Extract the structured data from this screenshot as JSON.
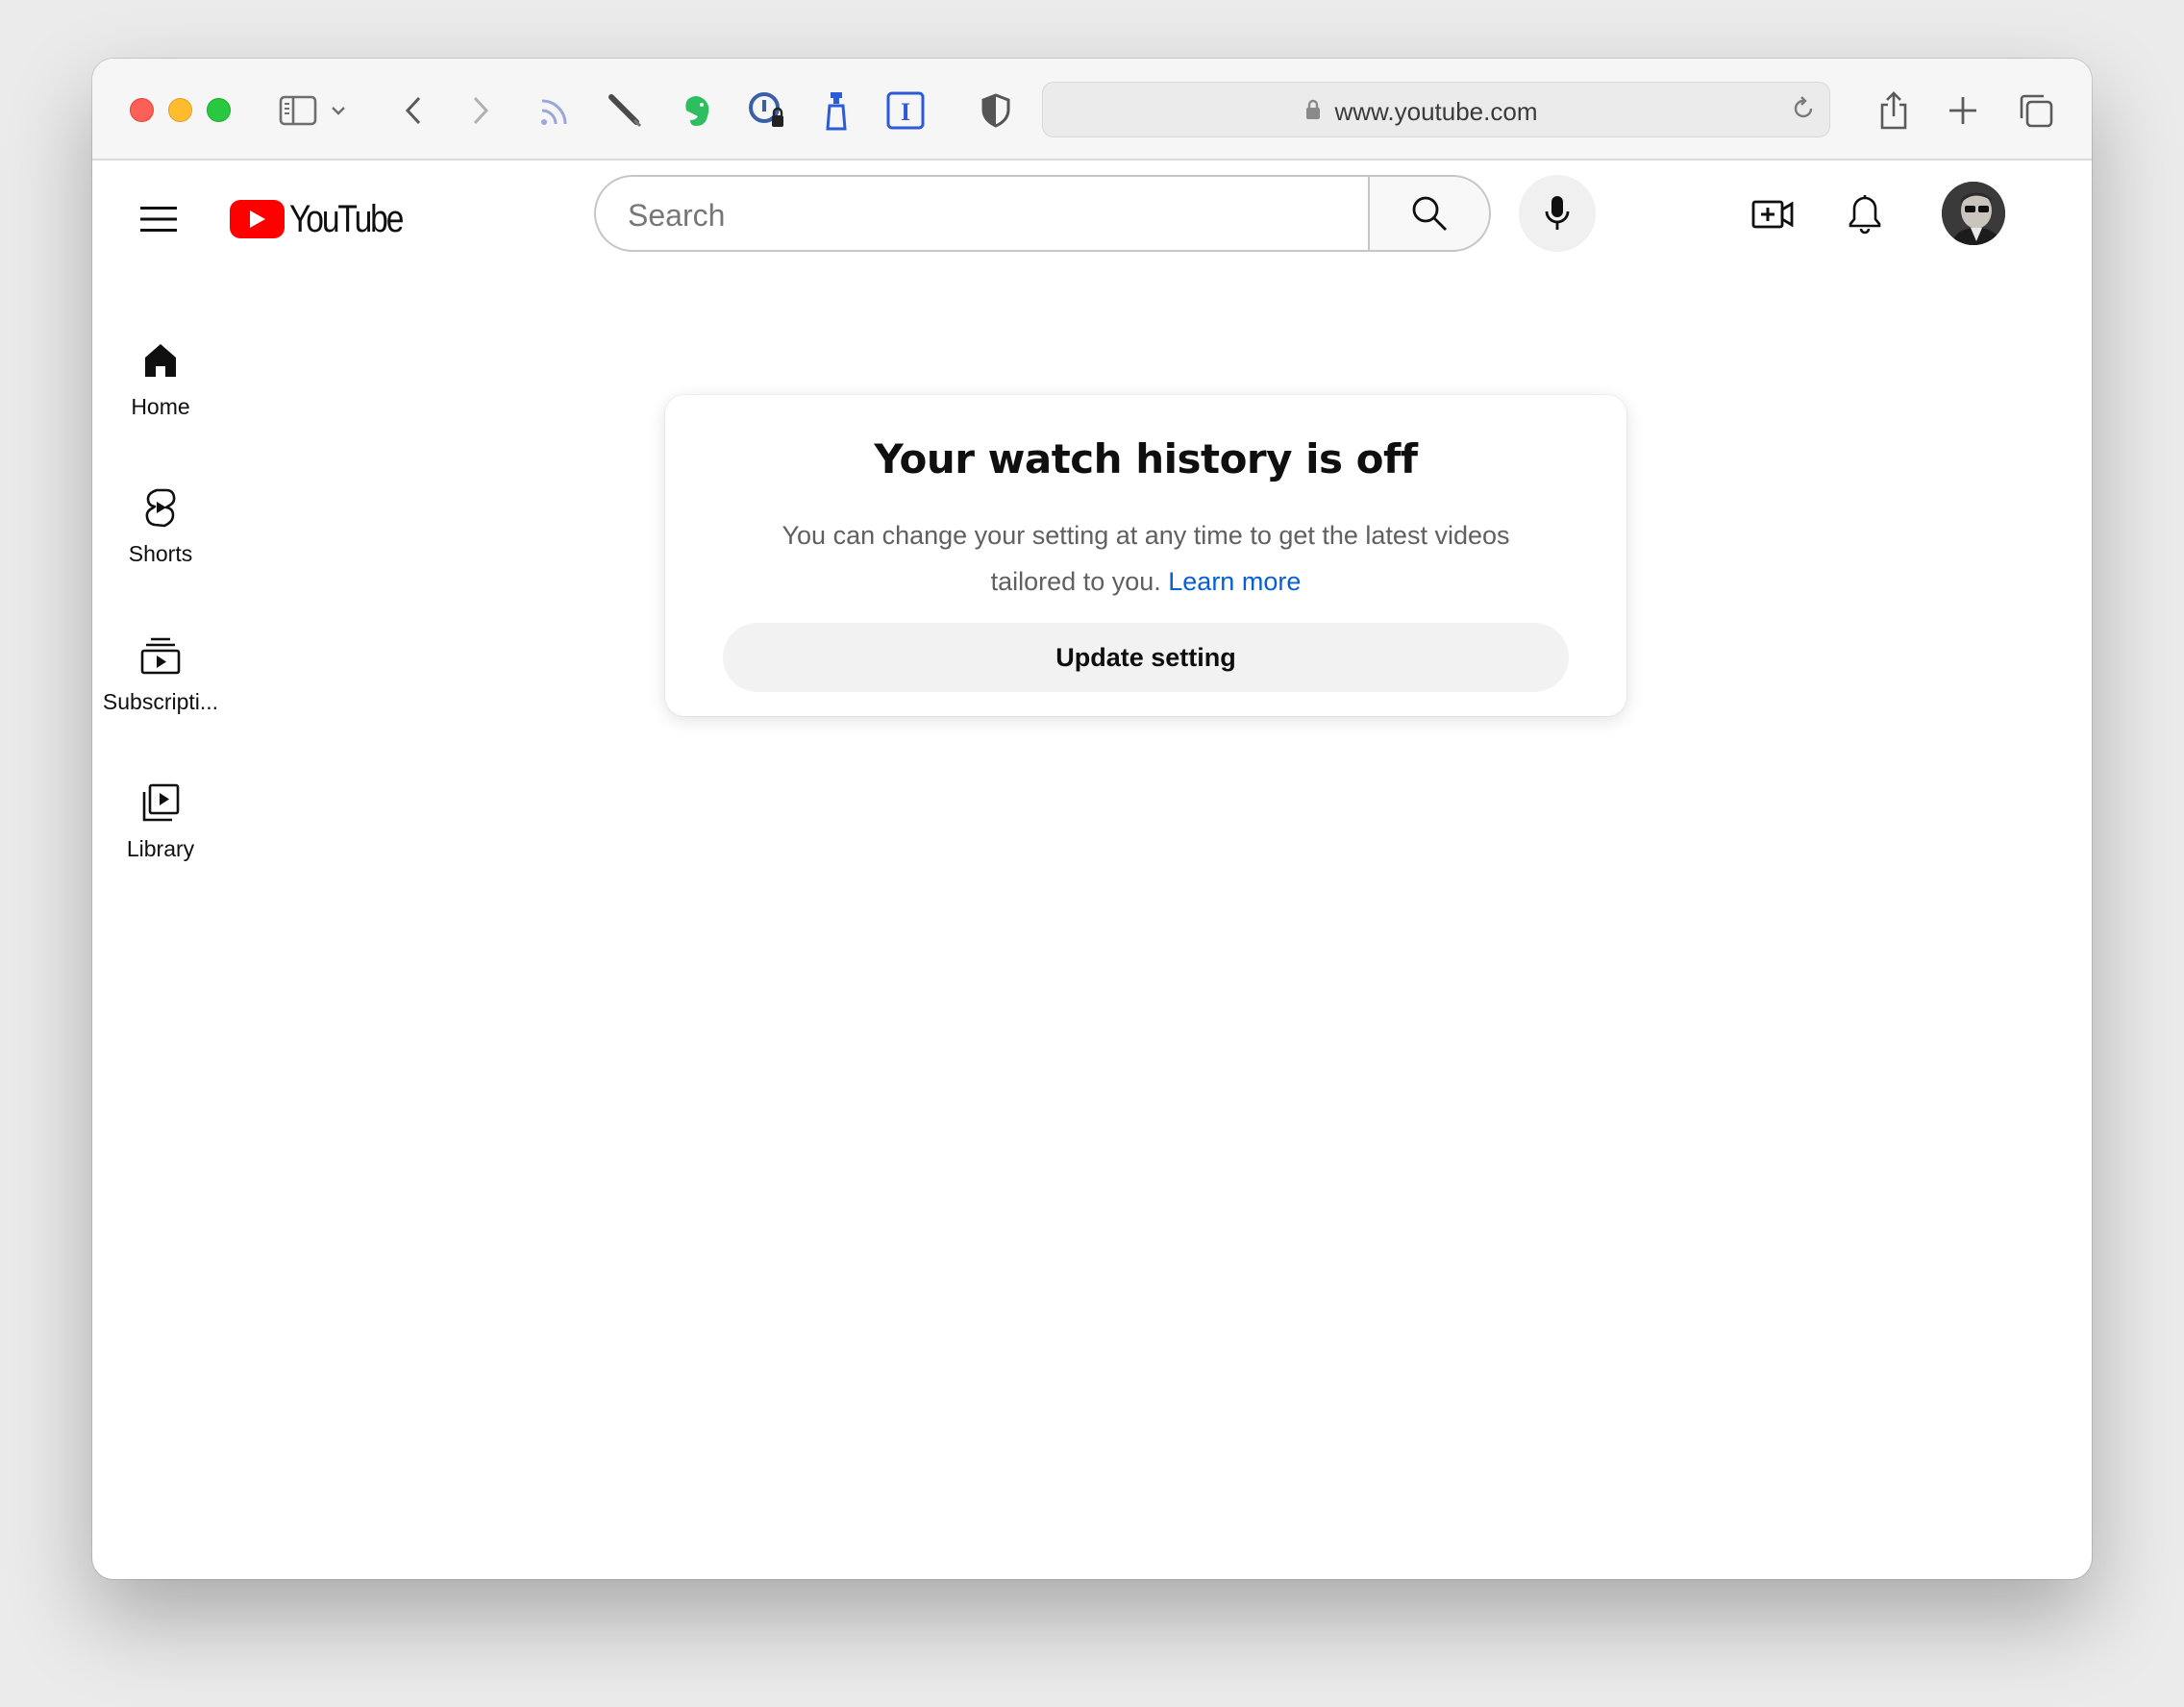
{
  "browser": {
    "url": "www.youtube.com",
    "toolbar_icons": [
      "sidebar-icon",
      "chevron-down-icon",
      "back-icon",
      "forward-icon",
      "rss-icon",
      "pen-icon",
      "evernote-icon",
      "password-manager-icon",
      "spray-bottle-icon",
      "instapaper-icon",
      "shield-icon",
      "share-icon",
      "new-tab-icon",
      "tab-overview-icon"
    ]
  },
  "header": {
    "logo_text": "YouTube",
    "search_placeholder": "Search"
  },
  "guide": {
    "items": [
      {
        "label": "Home",
        "icon": "home-icon"
      },
      {
        "label": "Shorts",
        "icon": "shorts-icon"
      },
      {
        "label": "Subscripti...",
        "icon": "subscriptions-icon"
      },
      {
        "label": "Library",
        "icon": "library-icon"
      }
    ]
  },
  "card": {
    "title": "Your watch history is off",
    "description_line1": "You can change your setting at any time to get the latest videos",
    "description_line2": "tailored to you.",
    "learn_more": "Learn more",
    "button_label": "Update setting"
  },
  "colors": {
    "brand_red": "#ff0000",
    "link_blue": "#065fd4",
    "text_primary": "#0f0f0f",
    "text_secondary": "#606060"
  }
}
